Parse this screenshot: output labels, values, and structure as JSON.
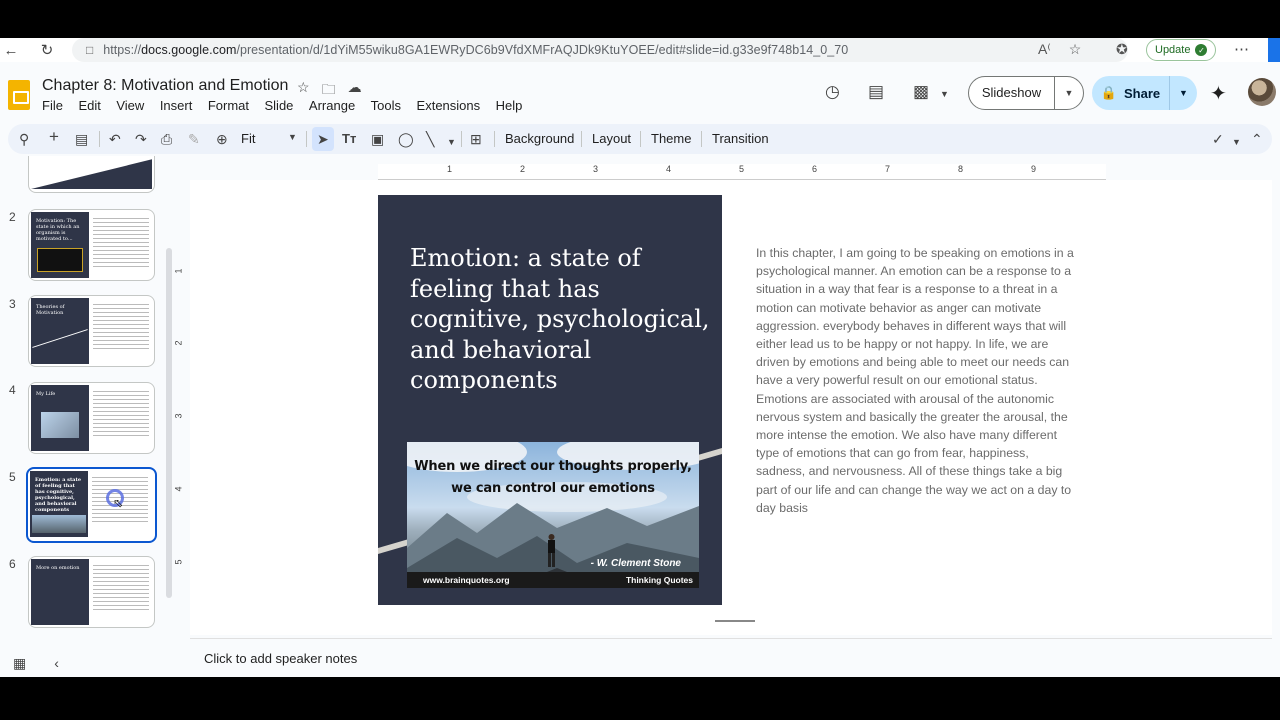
{
  "browser": {
    "url_prefix": "https://",
    "url_host": "docs.google.com",
    "url_path": "/presentation/d/1dYiM55wiku8GA1EWRyDC6b9VfdXMFrAQJDk9KtuYOEE/edit#slide=id.g33e9f748b14_0_70",
    "update_label": "Update"
  },
  "doc": {
    "title": "Chapter 8: Motivation and Emotion"
  },
  "menu": [
    "File",
    "Edit",
    "View",
    "Insert",
    "Format",
    "Slide",
    "Arrange",
    "Tools",
    "Extensions",
    "Help"
  ],
  "header": {
    "slideshow_label": "Slideshow",
    "share_label": "Share"
  },
  "toolbar": {
    "zoom_value": "Fit",
    "background_label": "Background",
    "layout_label": "Layout",
    "theme_label": "Theme",
    "transition_label": "Transition"
  },
  "filmstrip": {
    "slides": [
      {
        "number": "2",
        "title": "Motivation: The state in which an organism is motivated to..."
      },
      {
        "number": "3",
        "title": "Theories of Motivation"
      },
      {
        "number": "4",
        "title": "My Life"
      },
      {
        "number": "5",
        "title": "Emotion: a state of feeling that has cognitive, psychological, and behavioral components"
      },
      {
        "number": "6",
        "title": "More on emotion"
      }
    ]
  },
  "ruler": {
    "top": [
      "1",
      "2",
      "3",
      "4",
      "5",
      "6",
      "7",
      "8",
      "9"
    ],
    "left": [
      "1",
      "2",
      "3",
      "4",
      "5"
    ]
  },
  "slide": {
    "heading": "Emotion: a state of feeling that has cognitive, psychological, and behavioral components",
    "image_quote": "When we direct our thoughts properly, we can control our emotions",
    "image_attribution": "- W. Clement Stone",
    "image_site": "www.brainquotes.org",
    "image_brand": "Thinking Quotes",
    "body": "In this chapter, I am going to be speaking on emotions in a psychological manner. An emotion can be a response to a situation in a way that fear is a response to a threat in a motion can motivate behavior as anger can motivate aggression. everybody behaves in different ways that will either lead us to be happy or not happy. In life, we are driven by emotions and being able to meet our needs can have a very powerful result on our emotional status. Emotions are associated with arousal of the autonomic nervous system and basically the greater the arousal, the more intense the emotion. We also have many different type of emotions that can go from fear, happiness, sadness, and nervousness. All of these things take a big part of our life and can change the way we act on a day to day basis"
  },
  "notes": {
    "placeholder": "Click to add speaker notes"
  },
  "colors": {
    "accent": "#0b57d0",
    "slide_dark": "#2f3548",
    "share_bg": "#c2e7ff",
    "docs_yellow": "#f4b400"
  }
}
